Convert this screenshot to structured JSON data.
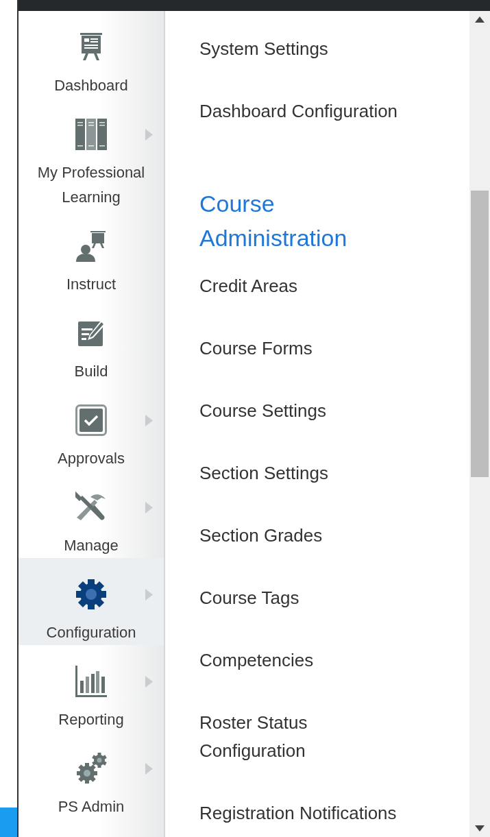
{
  "sidebar": {
    "items": [
      {
        "label": "Dashboard",
        "kind": "easel",
        "has_submenu": false,
        "selected": false
      },
      {
        "label": "My Professional Learning",
        "kind": "books",
        "has_submenu": true,
        "selected": false
      },
      {
        "label": "Instruct",
        "kind": "presenter",
        "has_submenu": false,
        "selected": false
      },
      {
        "label": "Build",
        "kind": "edit",
        "has_submenu": false,
        "selected": false
      },
      {
        "label": "Approvals",
        "kind": "checkbox",
        "has_submenu": true,
        "selected": false
      },
      {
        "label": "Manage",
        "kind": "tools",
        "has_submenu": true,
        "selected": false
      },
      {
        "label": "Configuration",
        "kind": "gear",
        "has_submenu": true,
        "selected": true
      },
      {
        "label": "Reporting",
        "kind": "chart",
        "has_submenu": true,
        "selected": false
      },
      {
        "label": "PS Admin",
        "kind": "gears",
        "has_submenu": true,
        "selected": false
      }
    ]
  },
  "menu": {
    "items": [
      {
        "kind": "link",
        "label": "System Settings"
      },
      {
        "kind": "link",
        "label": "Dashboard Configuration"
      },
      {
        "kind": "heading",
        "label": "Course Administration"
      },
      {
        "kind": "link",
        "label": "Credit Areas"
      },
      {
        "kind": "link",
        "label": "Course Forms"
      },
      {
        "kind": "link",
        "label": "Course Settings"
      },
      {
        "kind": "link",
        "label": "Section Settings"
      },
      {
        "kind": "link",
        "label": "Section Grades"
      },
      {
        "kind": "link",
        "label": "Course Tags"
      },
      {
        "kind": "link",
        "label": "Competencies"
      },
      {
        "kind": "link",
        "label": "Roster Status Configuration"
      },
      {
        "kind": "link",
        "label": "Registration Notifications"
      }
    ]
  }
}
